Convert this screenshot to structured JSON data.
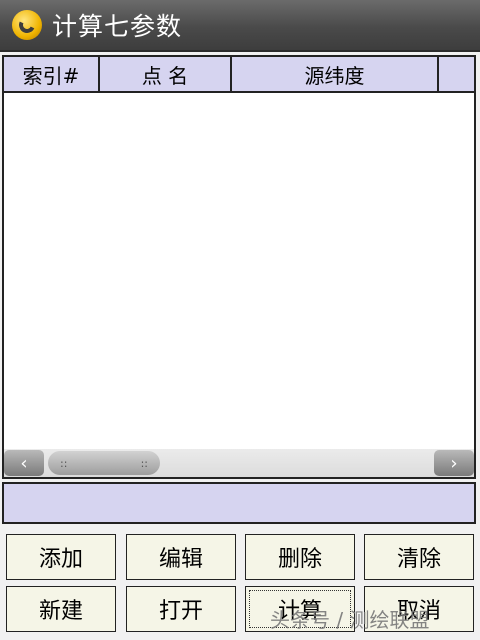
{
  "window": {
    "title": "计算七参数",
    "app_icon": "app-logo-icon"
  },
  "table": {
    "columns": [
      "索引#",
      "点 名",
      "源纬度",
      ""
    ],
    "rows": []
  },
  "scrollbar": {
    "left_arrow": "‹",
    "right_arrow": "›",
    "thumb_grip": "::"
  },
  "buttons": {
    "row1": [
      "添加",
      "编辑",
      "删除",
      "清除"
    ],
    "row2": [
      "新建",
      "打开",
      "计算",
      "取消"
    ]
  },
  "watermark": "头条号 / 测绘联盟"
}
